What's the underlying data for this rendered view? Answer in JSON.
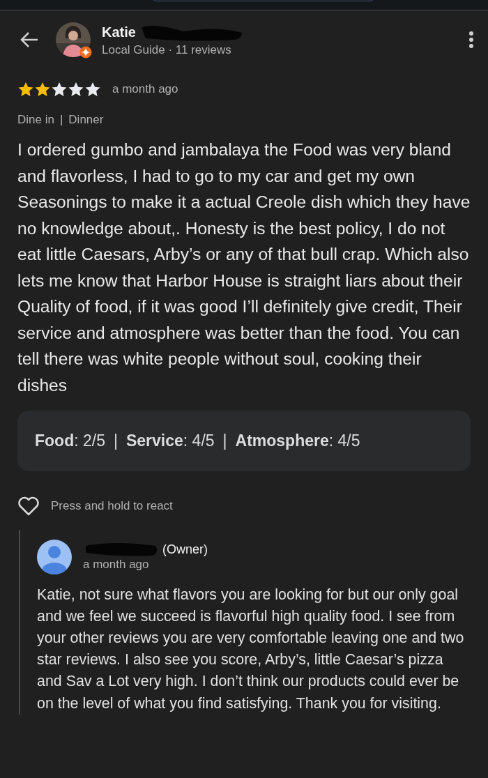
{
  "reviewer": {
    "name": "Katie",
    "subtitle": "Local Guide · 11 reviews"
  },
  "review": {
    "stars": 2,
    "time": "a month ago",
    "tags": [
      "Dine in",
      "|",
      "Dinner"
    ],
    "text": "I ordered gumbo and jambalaya the Food was very bland and flavorless, I had to go to my car and get my own Seasonings to make it a actual Creole dish which they have no knowledge about,. Honesty is the best policy, I do not eat little Caesars, Arby’s or any of that bull crap. Which also lets me know that Harbor House is straight liars about their Quality of food, if it was good I’ll definitely give credit, Their service and atmosphere was better than the food. You can tell there was white people without soul, cooking their dishes",
    "ratings": [
      {
        "label": "Food",
        "value": ": 2/5"
      },
      {
        "label": "Service",
        "value": ": 4/5"
      },
      {
        "label": "Atmosphere",
        "value": ": 4/5"
      }
    ],
    "separator": "|"
  },
  "react": {
    "label": "Press and hold to react",
    "liked": false
  },
  "reply": {
    "name": "(Owner)",
    "time": "a month ago",
    "text": "Katie, not sure what flavors you are looking for but our only goal and we feel we succeed is flavorful high quality food. I see from your other reviews you are very comfortable leaving one and two star reviews. I also see you score, Arby’s, little Caesar’s pizza and Sav a Lot very high. I don’t think our products could ever be on the level of what you find satisfying. Thank you for visiting."
  }
}
